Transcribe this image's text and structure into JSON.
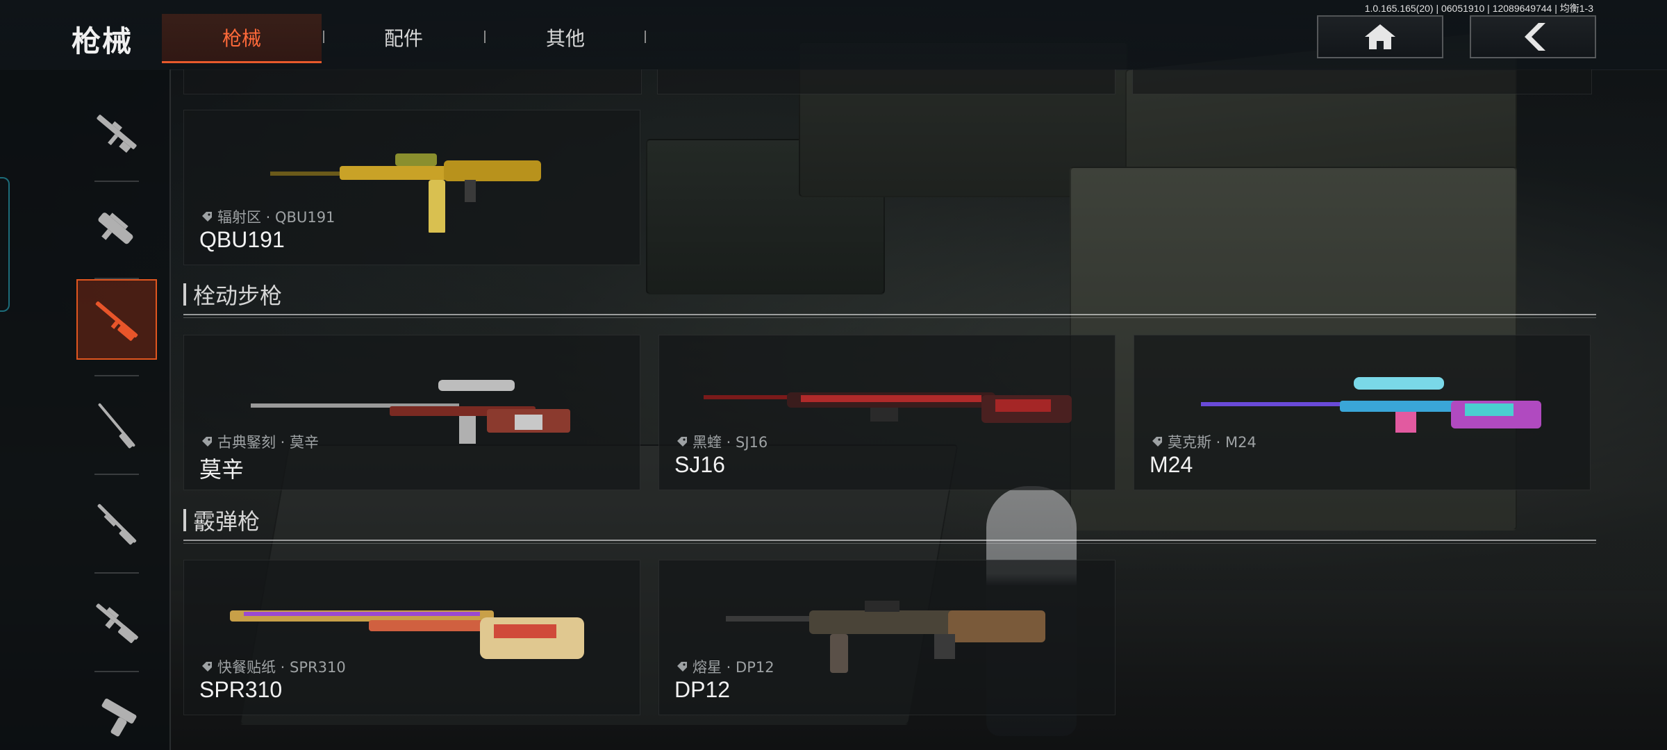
{
  "header": {
    "title": "枪械",
    "tabs": [
      {
        "label": "枪械",
        "active": true
      },
      {
        "label": "配件",
        "active": false
      },
      {
        "label": "其他",
        "active": false
      }
    ],
    "build_info": "1.0.165.165(20) | 06051910 | 12089649744 | 均衡1-3",
    "home_icon": "home-icon",
    "back_icon": "back-chevron-icon"
  },
  "sidebar": {
    "items": [
      {
        "icon": "assault-rifle-icon",
        "active": false
      },
      {
        "icon": "smg-icon",
        "active": false
      },
      {
        "icon": "bolt-action-rifle-icon",
        "active": true
      },
      {
        "icon": "marksman-rifle-icon",
        "active": false
      },
      {
        "icon": "shotgun-icon",
        "active": false
      },
      {
        "icon": "light-machine-gun-icon",
        "active": false
      },
      {
        "icon": "pistol-icon",
        "active": false
      }
    ]
  },
  "sections": {
    "top_card": {
      "skin": "辐射区 · QBU191",
      "name": "QBU191"
    },
    "bolt": {
      "title": "栓动步枪",
      "cards": [
        {
          "skin": "古典鋻刻 · 莫辛",
          "name": "莫辛"
        },
        {
          "skin": "黑蝰 · SJ16",
          "name": "SJ16"
        },
        {
          "skin": "莫克斯 · M24",
          "name": "M24"
        }
      ]
    },
    "shotgun": {
      "title": "霰弹枪",
      "cards": [
        {
          "skin": "快餐贴纸 · SPR310",
          "name": "SPR310"
        },
        {
          "skin": "熔星 · DP12",
          "name": "DP12"
        }
      ]
    }
  },
  "colors": {
    "accent": "#e85a2c",
    "accent_text": "#ff6a3a",
    "teal": "#1c6c7a"
  }
}
